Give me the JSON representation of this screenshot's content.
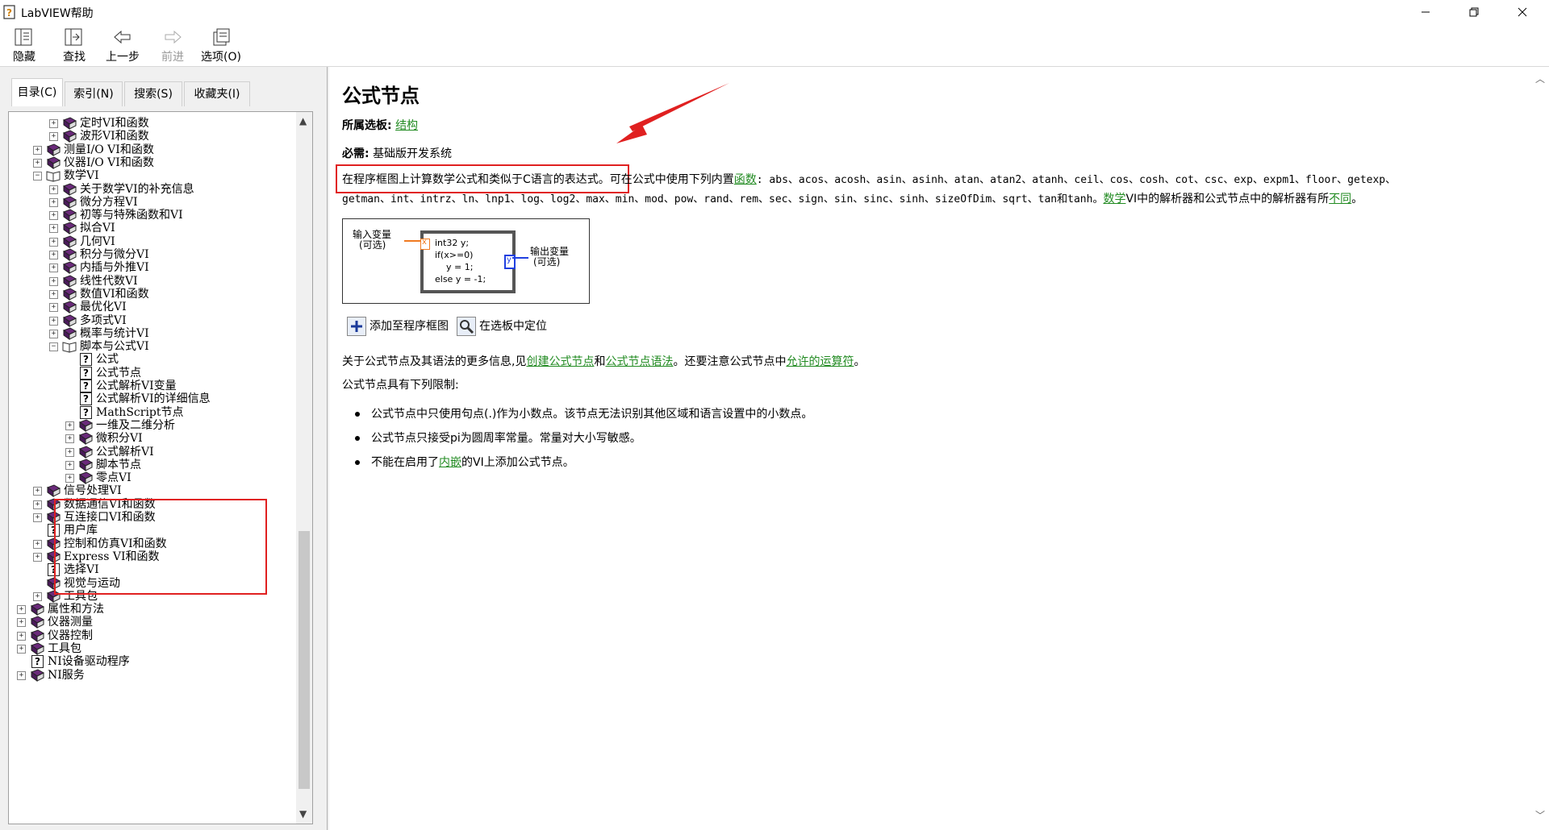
{
  "window": {
    "title": "LabVIEW帮助"
  },
  "toolbar": {
    "buttons": [
      {
        "label": "隐藏",
        "icon": "hide-icon"
      },
      {
        "label": "查找",
        "icon": "locate-icon"
      },
      {
        "label": "上一步",
        "icon": "back-arrow-icon"
      },
      {
        "label": "前进",
        "icon": "forward-arrow-icon"
      },
      {
        "label": "选项(O)",
        "icon": "options-icon"
      }
    ]
  },
  "tabs": [
    {
      "label": "目录(C)",
      "active": true
    },
    {
      "label": "索引(N)",
      "active": false
    },
    {
      "label": "搜索(S)",
      "active": false
    },
    {
      "label": "收藏夹(I)",
      "active": false
    }
  ],
  "tree": [
    {
      "label": "定时VI和函数",
      "level": 2,
      "kind": "book",
      "exp": "+"
    },
    {
      "label": "波形VI和函数",
      "level": 2,
      "kind": "book",
      "exp": "+"
    },
    {
      "label": "测量I/O VI和函数",
      "level": 1,
      "kind": "book",
      "exp": "+"
    },
    {
      "label": "仪器I/O VI和函数",
      "level": 1,
      "kind": "book",
      "exp": "+"
    },
    {
      "label": "数学VI",
      "level": 1,
      "kind": "open-book",
      "exp": "−"
    },
    {
      "label": "关于数学VI的补充信息",
      "level": 2,
      "kind": "book",
      "exp": "+"
    },
    {
      "label": "微分方程VI",
      "level": 2,
      "kind": "book",
      "exp": "+"
    },
    {
      "label": "初等与特殊函数和VI",
      "level": 2,
      "kind": "book",
      "exp": "+"
    },
    {
      "label": "拟合VI",
      "level": 2,
      "kind": "book",
      "exp": "+"
    },
    {
      "label": "几何VI",
      "level": 2,
      "kind": "book",
      "exp": "+"
    },
    {
      "label": "积分与微分VI",
      "level": 2,
      "kind": "book",
      "exp": "+"
    },
    {
      "label": "内插与外推VI",
      "level": 2,
      "kind": "book",
      "exp": "+"
    },
    {
      "label": "线性代数VI",
      "level": 2,
      "kind": "book",
      "exp": "+"
    },
    {
      "label": "数值VI和函数",
      "level": 2,
      "kind": "book",
      "exp": "+"
    },
    {
      "label": "最优化VI",
      "level": 2,
      "kind": "book",
      "exp": "+"
    },
    {
      "label": "多项式VI",
      "level": 2,
      "kind": "book",
      "exp": "+"
    },
    {
      "label": "概率与统计VI",
      "level": 2,
      "kind": "book",
      "exp": "+"
    },
    {
      "label": "脚本与公式VI",
      "level": 2,
      "kind": "open-book",
      "exp": "−"
    },
    {
      "label": "公式",
      "level": 3,
      "kind": "page",
      "exp": ""
    },
    {
      "label": "公式节点",
      "level": 3,
      "kind": "page",
      "exp": ""
    },
    {
      "label": "公式解析VI变量",
      "level": 3,
      "kind": "page",
      "exp": ""
    },
    {
      "label": "公式解析VI的详细信息",
      "level": 3,
      "kind": "page",
      "exp": ""
    },
    {
      "label": "MathScript节点",
      "level": 3,
      "kind": "page",
      "exp": ""
    },
    {
      "label": "一维及二维分析",
      "level": 3,
      "kind": "book",
      "exp": "+"
    },
    {
      "label": "微积分VI",
      "level": 3,
      "kind": "book",
      "exp": "+"
    },
    {
      "label": "公式解析VI",
      "level": 3,
      "kind": "book",
      "exp": "+"
    },
    {
      "label": "脚本节点",
      "level": 3,
      "kind": "book",
      "exp": "+"
    },
    {
      "label": "零点VI",
      "level": 3,
      "kind": "book",
      "exp": "+"
    },
    {
      "label": "信号处理VI",
      "level": 1,
      "kind": "book",
      "exp": "+"
    },
    {
      "label": "数据通信VI和函数",
      "level": 1,
      "kind": "book",
      "exp": "+"
    },
    {
      "label": "互连接口VI和函数",
      "level": 1,
      "kind": "book",
      "exp": "+"
    },
    {
      "label": "用户库",
      "level": 1,
      "kind": "page",
      "exp": ""
    },
    {
      "label": "控制和仿真VI和函数",
      "level": 1,
      "kind": "book",
      "exp": "+"
    },
    {
      "label": "Express VI和函数",
      "level": 1,
      "kind": "book",
      "exp": "+"
    },
    {
      "label": "选择VI",
      "level": 1,
      "kind": "page",
      "exp": ""
    },
    {
      "label": "视觉与运动",
      "level": 1,
      "kind": "book",
      "exp": ""
    },
    {
      "label": "工具包",
      "level": 1,
      "kind": "book",
      "exp": "+"
    },
    {
      "label": "属性和方法",
      "level": 0,
      "kind": "book",
      "exp": "+"
    },
    {
      "label": "仪器测量",
      "level": 0,
      "kind": "book",
      "exp": "+"
    },
    {
      "label": "仪器控制",
      "level": 0,
      "kind": "book",
      "exp": "+"
    },
    {
      "label": "工具包",
      "level": 0,
      "kind": "book",
      "exp": "+"
    },
    {
      "label": "NI设备驱动程序",
      "level": 0,
      "kind": "page",
      "exp": ""
    },
    {
      "label": "NI服务",
      "level": 0,
      "kind": "book",
      "exp": "+"
    }
  ],
  "doc": {
    "title": "公式节点",
    "palette_label": "所属选板:",
    "palette_link": "结构",
    "requires_label": "必需:",
    "requires_value": "基础版开发系统",
    "intro_highlight": "在程序框图上计算数学公式和类似于C语言的表达式。",
    "intro_rest": "可在公式中使用下列内置",
    "functions_link": "函数",
    "functions_line1": ": abs、acos、acosh、asin、asinh、atan、atan2、atanh、ceil、cos、cosh、cot、csc、exp、expm1、floor、getexp、",
    "functions_line2": "getman、int、intrz、ln、lnp1、log、log2、max、min、mod、pow、rand、rem、sec、sign、sin、sinc、sinh、sizeOfDim、sqrt、tan和tanh。",
    "math_vi_link": "数学",
    "parser_text": "VI中的解析器和公式节点中的解析器有所",
    "different_link": "不同",
    "period": "。",
    "diagram": {
      "input_label_1": "输入变量",
      "input_label_2": "(可选)",
      "output_label_1": "输出变量",
      "output_label_2": "(可选)",
      "code": "int32 y;\nif(x>=0)\n    y = 1;\nelse y = -1;",
      "in_term": "x",
      "out_term": "y"
    },
    "add_button": "添加至程序框图",
    "locate_button": "在选板中定位",
    "more_info_pre": "关于公式节点及其语法的更多信息,见",
    "create_link": "创建公式节点",
    "and": "和",
    "syntax_link": "公式节点语法",
    "more_info_mid": "。还要注意公式节点中",
    "operators_link": "允许的运算符",
    "more_info_end": "。",
    "limits_heading": "公式节点具有下列限制:",
    "bullets": [
      "公式节点中只使用句点(.)作为小数点。该节点无法识别其他区域和语言设置中的小数点。",
      "公式节点只接受pi为圆周率常量。常量对大小写敏感。"
    ],
    "bullet3_pre": "不能在启用了",
    "bullet3_link": "内嵌",
    "bullet3_post": "的VI上添加公式节点。"
  },
  "colors": {
    "link": "#228b22",
    "highlight_box": "#e02020",
    "book_icon": "#6a2a7a"
  }
}
